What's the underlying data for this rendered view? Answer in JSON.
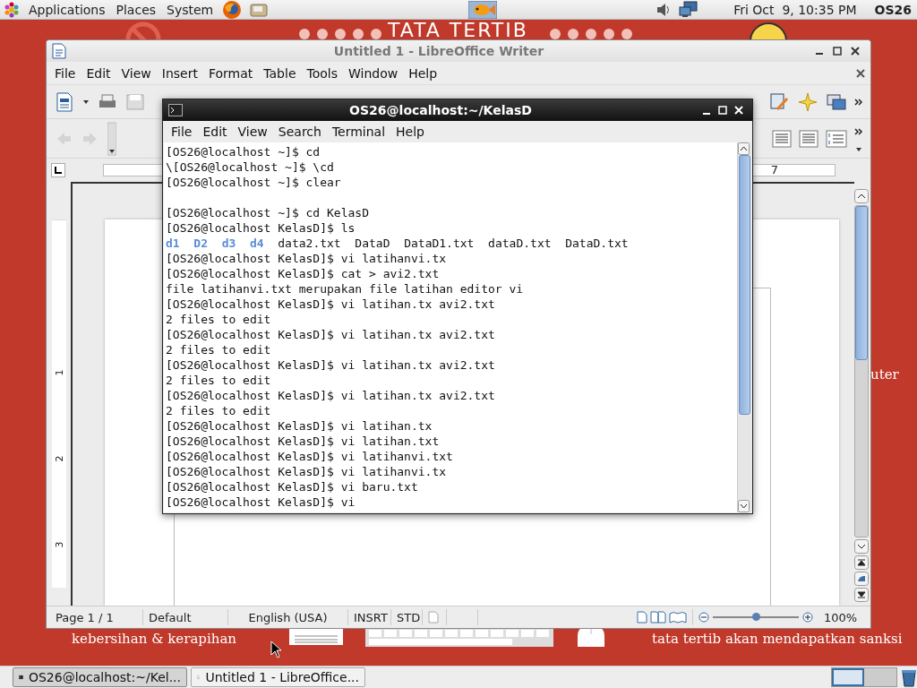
{
  "top_panel": {
    "menus": [
      "Applications",
      "Places",
      "System"
    ],
    "clock": "Fri Oct  9, 10:35 PM",
    "user": "OS26"
  },
  "wallpaper": {
    "heading": "TATA TERTIB",
    "side_text": "uter",
    "caption_left": "kebersihan & kerapihan",
    "caption_right": "tata tertib akan mendapatkan sanksi"
  },
  "writer": {
    "title": "Untitled 1 - LibreOffice Writer",
    "menu": [
      "File",
      "Edit",
      "View",
      "Insert",
      "Format",
      "Table",
      "Tools",
      "Window",
      "Help"
    ],
    "ruler_label": "7",
    "vertical_ruler_labels": [
      "1",
      "2",
      "3"
    ],
    "status_bar": {
      "page": "Page 1 / 1",
      "style": "Default",
      "language": "English (USA)",
      "insert_mode": "INSRT",
      "selection_mode": "STD",
      "zoom": "100%",
      "zoom_slider": {
        "level": 0.5
      }
    }
  },
  "terminal": {
    "title": "OS26@localhost:~/KelasD",
    "menu": [
      "File",
      "Edit",
      "View",
      "Search",
      "Terminal",
      "Help"
    ],
    "lines": [
      {
        "kind": "text",
        "text": "[OS26@localhost ~]$ cd"
      },
      {
        "kind": "text",
        "text": "\\[OS26@localhost ~]$ \\cd"
      },
      {
        "kind": "text",
        "text": "[OS26@localhost ~]$ clear"
      },
      {
        "kind": "blank"
      },
      {
        "kind": "text",
        "text": "[OS26@localhost ~]$ cd KelasD"
      },
      {
        "kind": "text",
        "text": "[OS26@localhost KelasD]$ ls"
      },
      {
        "kind": "listing",
        "entries": [
          {
            "text": "d1",
            "kind": "dir"
          },
          {
            "text": "D2",
            "kind": "dir"
          },
          {
            "text": "d3",
            "kind": "dir"
          },
          {
            "text": "d4",
            "kind": "dir"
          },
          {
            "text": "data2.txt",
            "kind": "file"
          },
          {
            "text": "DataD",
            "kind": "file"
          },
          {
            "text": "DataD1.txt",
            "kind": "file"
          },
          {
            "text": "dataD.txt",
            "kind": "file"
          },
          {
            "text": "DataD.txt",
            "kind": "file"
          }
        ]
      },
      {
        "kind": "text",
        "text": "[OS26@localhost KelasD]$ vi latihanvi.tx"
      },
      {
        "kind": "text",
        "text": "[OS26@localhost KelasD]$ cat > avi2.txt"
      },
      {
        "kind": "text",
        "text": "file latihanvi.txt merupakan file latihan editor vi"
      },
      {
        "kind": "text",
        "text": "[OS26@localhost KelasD]$ vi latihan.tx avi2.txt"
      },
      {
        "kind": "text",
        "text": "2 files to edit"
      },
      {
        "kind": "text",
        "text": "[OS26@localhost KelasD]$ vi latihan.tx avi2.txt"
      },
      {
        "kind": "text",
        "text": "2 files to edit"
      },
      {
        "kind": "text",
        "text": "[OS26@localhost KelasD]$ vi latihan.tx avi2.txt"
      },
      {
        "kind": "text",
        "text": "2 files to edit"
      },
      {
        "kind": "text",
        "text": "[OS26@localhost KelasD]$ vi latihan.tx avi2.txt"
      },
      {
        "kind": "text",
        "text": "2 files to edit"
      },
      {
        "kind": "text",
        "text": "[OS26@localhost KelasD]$ vi latihan.tx"
      },
      {
        "kind": "text",
        "text": "[OS26@localhost KelasD]$ vi latihan.txt"
      },
      {
        "kind": "text",
        "text": "[OS26@localhost KelasD]$ vi latihanvi.txt"
      },
      {
        "kind": "text",
        "text": "[OS26@localhost KelasD]$ vi latihanvi.tx"
      },
      {
        "kind": "text",
        "text": "[OS26@localhost KelasD]$ vi baru.txt"
      },
      {
        "kind": "text",
        "text": "[OS26@localhost KelasD]$ vi"
      }
    ]
  },
  "taskbar": {
    "tasks": [
      {
        "label": "OS26@localhost:~/Kel...",
        "selected": true
      },
      {
        "label": "Untitled 1 - LibreOffice...",
        "selected": false
      }
    ],
    "workspaces": [
      {
        "selected": true
      },
      {
        "selected": false
      }
    ]
  }
}
